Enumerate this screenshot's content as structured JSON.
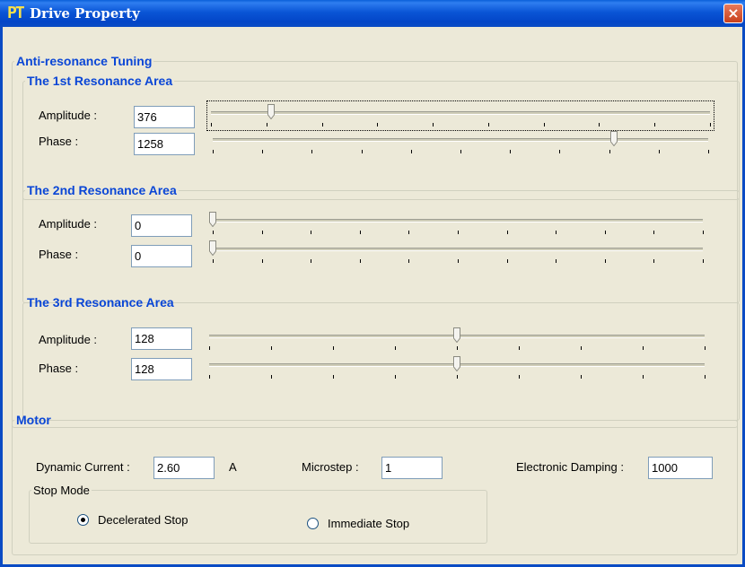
{
  "window": {
    "icon_text": "PT",
    "title": "Drive Property",
    "close_label": "×"
  },
  "anti_resonance": {
    "legend": "Anti-resonance Tuning",
    "areas": [
      {
        "legend": "The 1st Resonance Area",
        "amplitude": {
          "label": "Amplitude :",
          "value": "376",
          "slider_fraction": 0.12,
          "ticks": 10
        },
        "phase": {
          "label": "Phase :",
          "value": "1258",
          "slider_fraction": 0.81,
          "ticks": 11
        }
      },
      {
        "legend": "The 2nd Resonance Area",
        "amplitude": {
          "label": "Amplitude :",
          "value": "0",
          "slider_fraction": 0.0,
          "ticks": 11
        },
        "phase": {
          "label": "Phase :",
          "value": "0",
          "slider_fraction": 0.0,
          "ticks": 11
        }
      },
      {
        "legend": "The 3rd Resonance Area",
        "amplitude": {
          "label": "Amplitude :",
          "value": "128",
          "slider_fraction": 0.5,
          "ticks": 9
        },
        "phase": {
          "label": "Phase :",
          "value": "128",
          "slider_fraction": 0.5,
          "ticks": 9
        }
      }
    ]
  },
  "motor": {
    "legend": "Motor",
    "dynamic_current": {
      "label": "Dynamic Current :",
      "value": "2.60",
      "unit": "A"
    },
    "microstep": {
      "label": "Microstep :",
      "value": "1"
    },
    "electronic_damping": {
      "label": "Electronic Damping :",
      "value": "1000"
    },
    "stop_mode": {
      "legend": "Stop Mode",
      "options": [
        {
          "label": "Decelerated Stop",
          "selected": true
        },
        {
          "label": "Immediate Stop",
          "selected": false
        }
      ]
    }
  }
}
